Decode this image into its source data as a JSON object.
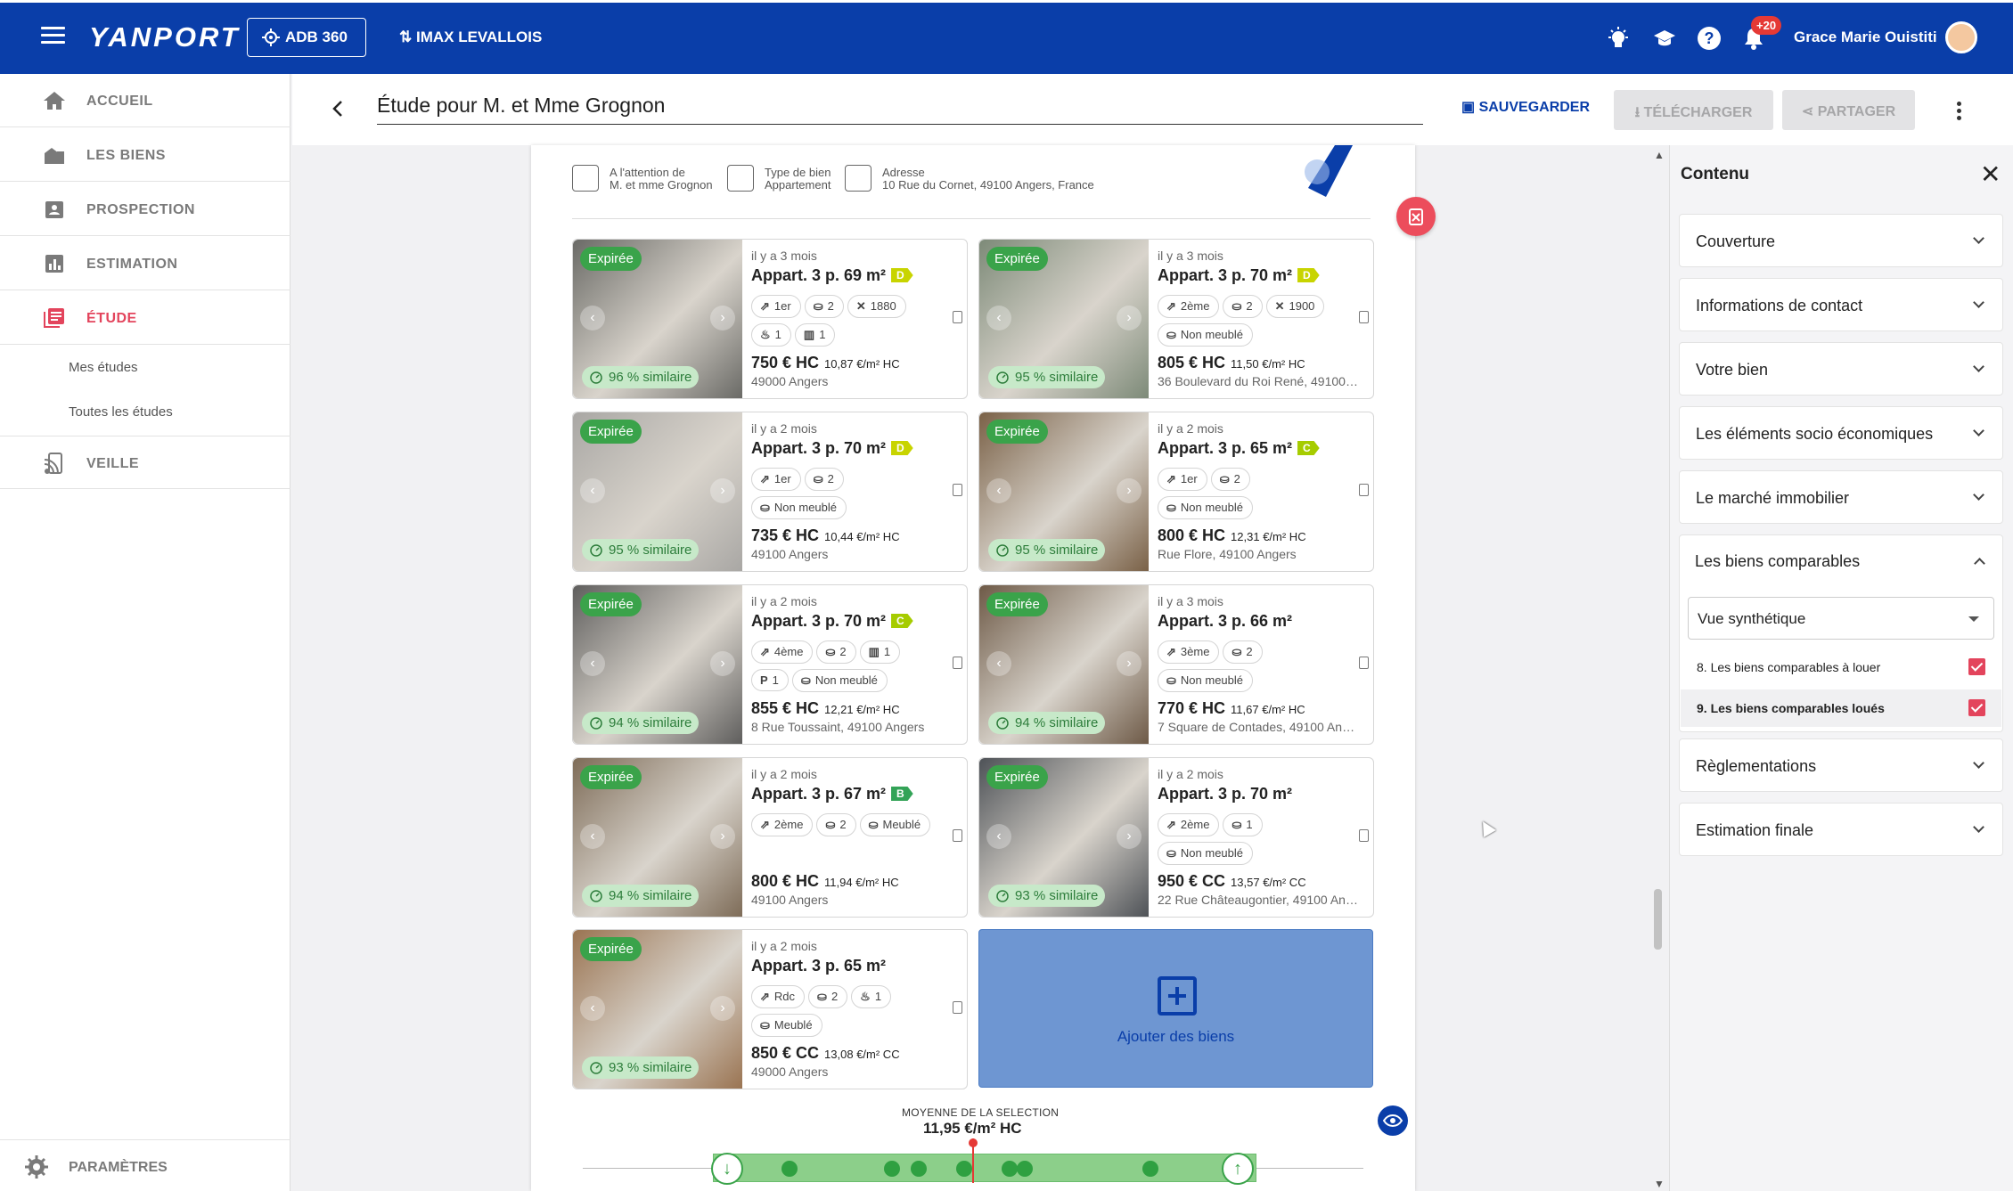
{
  "topbar": {
    "brand": "YANPORT",
    "adb_label": "ADB 360",
    "agency": "IMAX LEVALLOIS",
    "notif_count": "+20",
    "user_name": "Grace Marie Ouistiti",
    "bg_color": "#0a3ea9"
  },
  "sidebar": {
    "items": [
      {
        "label": "ACCUEIL"
      },
      {
        "label": "LES BIENS"
      },
      {
        "label": "PROSPECTION"
      },
      {
        "label": "ESTIMATION"
      },
      {
        "label": "ÉTUDE"
      },
      {
        "label": "VEILLE"
      }
    ],
    "sub_items": [
      {
        "label": "Mes études"
      },
      {
        "label": "Toutes les études"
      }
    ],
    "settings": "PARAMÈTRES",
    "active_color": "#e3445c"
  },
  "header": {
    "title": "Étude pour M. et Mme Grognon",
    "save": "SAUVEGARDER",
    "download": "TÉLÉCHARGER",
    "share": "PARTAGER"
  },
  "doc": {
    "attention_label": "A l'attention de",
    "attention_value": "M. et mme Grognon",
    "type_label": "Type de bien",
    "type_value": "Appartement",
    "address_label": "Adresse",
    "address_value": "10 Rue du Cornet, 49100 Angers, France"
  },
  "listings": [
    {
      "badge": "Expirée",
      "date": "il y a 3 mois",
      "title": "Appart. 3 p. 69 m²",
      "dpe": "D",
      "dpe_color": "#c8d400",
      "chips": [
        [
          "⇗",
          "1er"
        ],
        [
          "⛀",
          "2"
        ],
        [
          "✕",
          "1880"
        ],
        [
          "♨",
          "1"
        ],
        [
          "▥",
          "1"
        ]
      ],
      "price": "750 € HC",
      "ppm": "10,87 €/m² HC",
      "address": "49000 Angers",
      "similar": "96 % similaire",
      "photo": "#6a6a66"
    },
    {
      "badge": "Expirée",
      "date": "il y a 3 mois",
      "title": "Appart. 3 p. 70 m²",
      "dpe": "D",
      "dpe_color": "#c8d400",
      "chips": [
        [
          "⇗",
          "2ème"
        ],
        [
          "⛀",
          "2"
        ],
        [
          "✕",
          "1900"
        ],
        [
          "⛀",
          "Non meublé"
        ]
      ],
      "price": "805 € HC",
      "ppm": "11,50 €/m² HC",
      "address": "36 Boulevard du Roi René, 49100 Angers",
      "similar": "95 % similaire",
      "photo": "#7d8a78"
    },
    {
      "badge": "Expirée",
      "date": "il y a 2 mois",
      "title": "Appart. 3 p. 70 m²",
      "dpe": "D",
      "dpe_color": "#c8d400",
      "chips": [
        [
          "⇗",
          "1er"
        ],
        [
          "⛀",
          "2"
        ],
        [
          "⛀",
          "Non meublé"
        ]
      ],
      "price": "735 € HC",
      "ppm": "10,44 €/m² HC",
      "address": "49100 Angers",
      "similar": "95 % similaire",
      "photo": "#a9a7a4"
    },
    {
      "badge": "Expirée",
      "date": "il y a 2 mois",
      "title": "Appart. 3 p. 65 m²",
      "dpe": "C",
      "dpe_color": "#a6cc00",
      "chips": [
        [
          "⇗",
          "1er"
        ],
        [
          "⛀",
          "2"
        ],
        [
          "⛀",
          "Non meublé"
        ]
      ],
      "price": "800 € HC",
      "ppm": "12,31 €/m² HC",
      "address": "Rue Flore, 49100 Angers",
      "similar": "95 % similaire",
      "photo": "#7a6147"
    },
    {
      "badge": "Expirée",
      "date": "il y a 2 mois",
      "title": "Appart. 3 p. 70 m²",
      "dpe": "C",
      "dpe_color": "#a6cc00",
      "chips": [
        [
          "⇗",
          "4ème"
        ],
        [
          "⛀",
          "2"
        ],
        [
          "▥",
          "1"
        ],
        [
          "P",
          "1"
        ],
        [
          "⛀",
          "Non meublé"
        ]
      ],
      "price": "855 € HC",
      "ppm": "12,21 €/m² HC",
      "address": "8 Rue Toussaint, 49100 Angers",
      "similar": "94 % similaire",
      "photo": "#5f5e5d"
    },
    {
      "badge": "Expirée",
      "date": "il y a 3 mois",
      "title": "Appart. 3 p. 66 m²",
      "dpe": "",
      "dpe_color": "",
      "chips": [
        [
          "⇗",
          "3ème"
        ],
        [
          "⛀",
          "2"
        ],
        [
          "⛀",
          "Non meublé"
        ]
      ],
      "price": "770 € HC",
      "ppm": "11,67 €/m² HC",
      "address": "7 Square de Contades, 49100 Angers",
      "similar": "94 % similaire",
      "photo": "#6e5a47"
    },
    {
      "badge": "Expirée",
      "date": "il y a 2 mois",
      "title": "Appart. 3 p. 67 m²",
      "dpe": "B",
      "dpe_color": "#33a357",
      "chips": [
        [
          "⇗",
          "2ème"
        ],
        [
          "⛀",
          "2"
        ],
        [
          "⛀",
          "Meublé"
        ]
      ],
      "price": "800 € HC",
      "ppm": "11,94 €/m² HC",
      "address": "49100 Angers",
      "similar": "94 % similaire",
      "photo": "#7e6c58"
    },
    {
      "badge": "Expirée",
      "date": "il y a 2 mois",
      "title": "Appart. 3 p. 70 m²",
      "dpe": "",
      "dpe_color": "",
      "chips": [
        [
          "⇗",
          "2ème"
        ],
        [
          "⛀",
          "1"
        ],
        [
          "⛀",
          "Non meublé"
        ]
      ],
      "price": "950 € CC",
      "ppm": "13,57 €/m² CC",
      "address": "22 Rue Châteaugontier, 49100 Angers",
      "similar": "93 % similaire",
      "photo": "#4e5257"
    },
    {
      "badge": "Expirée",
      "date": "il y a 2 mois",
      "title": "Appart. 3 p. 65 m²",
      "dpe": "",
      "dpe_color": "",
      "chips": [
        [
          "⇗",
          "Rdc"
        ],
        [
          "⛀",
          "2"
        ],
        [
          "♨",
          "1"
        ],
        [
          "⛀",
          "Meublé"
        ]
      ],
      "price": "850 € CC",
      "ppm": "13,08 €/m² CC",
      "address": "49000 Angers",
      "similar": "93 % similaire",
      "photo": "#9a7452"
    }
  ],
  "add_card": {
    "label": "Ajouter des biens"
  },
  "average": {
    "label": "MOYENNE DE LA SELECTION",
    "value": "11,95 €/m² HC"
  },
  "panel": {
    "title": "Contenu",
    "sections": [
      "Couverture",
      "Informations de contact",
      "Votre bien",
      "Les éléments socio économiques",
      "Le marché immobilier",
      "Les biens comparables",
      "Règlementations",
      "Estimation finale"
    ],
    "view_select": "Vue synthétique",
    "checks": [
      "8. Les biens comparables à louer",
      "9. Les biens comparables loués"
    ]
  }
}
